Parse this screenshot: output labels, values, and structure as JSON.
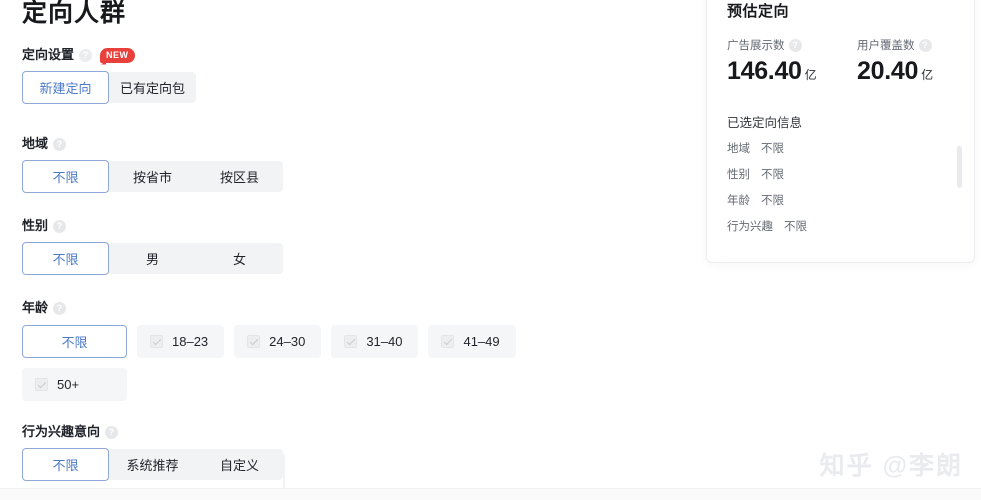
{
  "page": {
    "title": "定向人群",
    "help_icon": "question-circle-icon",
    "watermark": "知乎 @李朗"
  },
  "fields": {
    "targeting_mode": {
      "label": "定向设置",
      "badge": "NEW",
      "options": [
        "新建定向",
        "已有定向包"
      ],
      "selected": "新建定向"
    },
    "region": {
      "label": "地域",
      "options": [
        "不限",
        "按省市",
        "按区县"
      ],
      "selected": "不限"
    },
    "gender": {
      "label": "性别",
      "options": [
        "不限",
        "男",
        "女"
      ],
      "selected": "不限"
    },
    "age": {
      "label": "年龄",
      "unlimited_label": "不限",
      "selected": "不限",
      "chips_row1": [
        "18–23",
        "24–30",
        "31–40",
        "41–49"
      ],
      "chips_row2": [
        "50+"
      ]
    },
    "interest": {
      "label": "行为兴趣意向",
      "options": [
        "不限",
        "系统推荐",
        "自定义"
      ],
      "selected": "不限"
    }
  },
  "estimate": {
    "title": "预估定向",
    "metrics": [
      {
        "label": "广告展示数",
        "value": "146.40",
        "unit": "亿"
      },
      {
        "label": "用户覆盖数",
        "value": "20.40",
        "unit": "亿"
      }
    ],
    "selected_title": "已选定向信息",
    "selected_rows": [
      {
        "key": "地域",
        "value": "不限"
      },
      {
        "key": "性别",
        "value": "不限"
      },
      {
        "key": "年龄",
        "value": "不限"
      },
      {
        "key": "行为兴趣",
        "value": "不限"
      }
    ]
  },
  "colors": {
    "accent_blue": "#4c7ac9",
    "accent_border": "#8ea8d8",
    "badge_red": "#e8403a",
    "track_gray": "#f2f3f5",
    "chip_gray": "#f5f6f7"
  }
}
